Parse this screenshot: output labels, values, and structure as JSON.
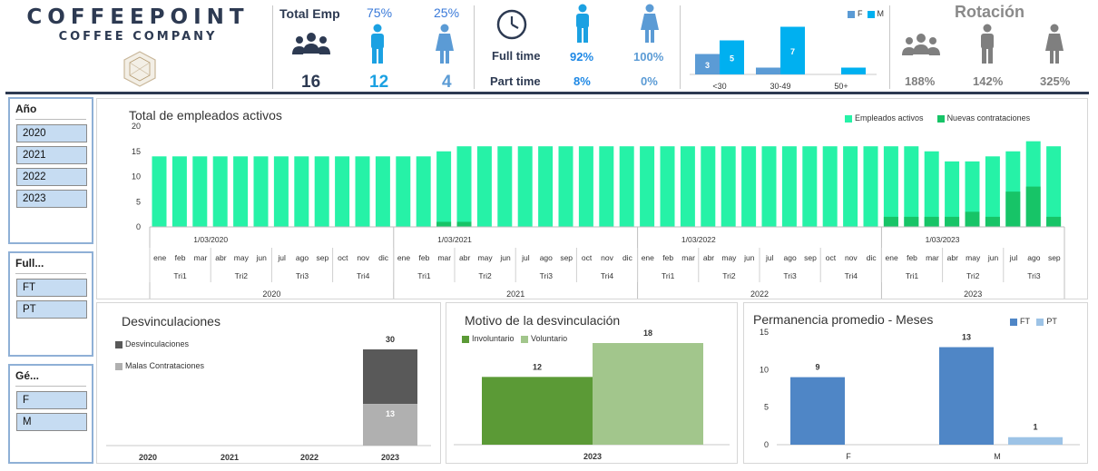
{
  "header": {
    "logo_title": "COFFEEPOINT",
    "logo_subtitle": "COFFEE COMPANY",
    "total_emp_label": "Total Emp",
    "total_emp_value": "16",
    "male_pct": "75%",
    "male_value": "12",
    "female_pct": "25%",
    "female_value": "4",
    "full_time_label": "Full time",
    "part_time_label": "Part time",
    "full_time_male": "92%",
    "full_time_female": "100%",
    "part_time_male": "8%",
    "part_time_female": "0%",
    "rotation_title": "Rotación",
    "rotation_total": "188%",
    "rotation_male": "142%",
    "rotation_female": "325%",
    "colors": {
      "navy": "#2d3a52",
      "blue": "#1ba1e2",
      "female_blue": "#5b9bd5",
      "gray_icon": "#7f7f7f"
    }
  },
  "age_chart": {
    "legend": [
      "F",
      "M"
    ],
    "colors": {
      "F": "#5b9bd5",
      "M": "#00b0f0"
    },
    "chart_data": {
      "type": "bar",
      "categories": [
        "<30",
        "30-49",
        "50+"
      ],
      "series": [
        {
          "name": "F",
          "values": [
            3,
            1,
            0
          ]
        },
        {
          "name": "M",
          "values": [
            5,
            7,
            1
          ]
        }
      ],
      "data_labels": {
        "F": [
          "3",
          "",
          ""
        ],
        "M": [
          "5",
          "7",
          ""
        ]
      }
    }
  },
  "slicers": {
    "year": {
      "title": "Año",
      "items": [
        "2020",
        "2021",
        "2022",
        "2023"
      ]
    },
    "contract": {
      "title": "Full...",
      "items": [
        "FT",
        "PT"
      ]
    },
    "gender": {
      "title": "Gé...",
      "items": [
        "F",
        "M"
      ]
    }
  },
  "main_chart": {
    "title": "Total de empleados activos",
    "legend": [
      "Empleados activos",
      "Nuevas contrataciones"
    ],
    "colors": {
      "active": "#26f2a7",
      "new": "#17c467"
    },
    "y_ticks": [
      "0",
      "5",
      "10",
      "15",
      "20"
    ],
    "months": [
      "ene",
      "feb",
      "mar",
      "abr",
      "may",
      "jun",
      "jul",
      "ago",
      "sep",
      "oct",
      "nov",
      "dic"
    ],
    "quarters": [
      "Tri1",
      "Tri2",
      "Tri3",
      "Tri4"
    ],
    "quarter_date": [
      "1/03/2020",
      "1/03/2021",
      "1/03/2022",
      "1/03/2023"
    ],
    "years": [
      "2020",
      "2021",
      "2022",
      "2023"
    ],
    "chart_data": {
      "type": "bar",
      "ylim": [
        0,
        20
      ],
      "x": [
        "2020-01",
        "2020-02",
        "2020-03",
        "2020-04",
        "2020-05",
        "2020-06",
        "2020-07",
        "2020-08",
        "2020-09",
        "2020-10",
        "2020-11",
        "2020-12",
        "2021-01",
        "2021-02",
        "2021-03",
        "2021-04",
        "2021-05",
        "2021-06",
        "2021-07",
        "2021-08",
        "2021-09",
        "2021-10",
        "2021-11",
        "2021-12",
        "2022-01",
        "2022-02",
        "2022-03",
        "2022-04",
        "2022-05",
        "2022-06",
        "2022-07",
        "2022-08",
        "2022-09",
        "2022-10",
        "2022-11",
        "2022-12",
        "2023-01",
        "2023-02",
        "2023-03",
        "2023-04",
        "2023-05",
        "2023-06",
        "2023-07",
        "2023-08",
        "2023-09"
      ],
      "series": [
        {
          "name": "Empleados activos",
          "values": [
            14,
            14,
            14,
            14,
            14,
            14,
            14,
            14,
            14,
            14,
            14,
            14,
            14,
            14,
            15,
            16,
            16,
            16,
            16,
            16,
            16,
            16,
            16,
            16,
            16,
            16,
            16,
            16,
            16,
            16,
            16,
            16,
            16,
            16,
            16,
            16,
            16,
            16,
            15,
            13,
            13,
            14,
            15,
            17,
            16
          ]
        },
        {
          "name": "Nuevas contrataciones",
          "values": [
            0,
            0,
            0,
            0,
            0,
            0,
            0,
            0,
            0,
            0,
            0,
            0,
            0,
            0,
            1,
            1,
            0,
            0,
            0,
            0,
            0,
            0,
            0,
            0,
            0,
            0,
            0,
            0,
            0,
            0,
            0,
            0,
            0,
            0,
            0,
            0,
            2,
            2,
            2,
            2,
            3,
            2,
            7,
            8,
            2
          ]
        }
      ]
    }
  },
  "desvinc_chart": {
    "title": "Desvinculaciones",
    "legend": [
      "Desvinculaciones",
      "Malas Contrataciones"
    ],
    "colors": {
      "desv": "#595959",
      "malas": "#b0b0b0"
    },
    "chart_data": {
      "type": "bar",
      "categories": [
        "2020",
        "2021",
        "2022",
        "2023"
      ],
      "series": [
        {
          "name": "Desvinculaciones",
          "values": [
            0,
            0,
            0,
            30
          ]
        },
        {
          "name": "Malas Contrataciones",
          "values": [
            0,
            0,
            0,
            13
          ]
        }
      ],
      "data_labels": {
        "total": "30",
        "malas": "13"
      }
    }
  },
  "motivo_chart": {
    "title": "Motivo de la desvinculación",
    "legend": [
      "Involuntario",
      "Voluntario"
    ],
    "colors": {
      "inv": "#5b9a36",
      "vol": "#a2c68c"
    },
    "chart_data": {
      "type": "bar",
      "categories": [
        "2023"
      ],
      "series": [
        {
          "name": "Involuntario",
          "values": [
            12
          ]
        },
        {
          "name": "Voluntario",
          "values": [
            18
          ]
        }
      ],
      "data_labels": [
        "12",
        "18"
      ]
    }
  },
  "perm_chart": {
    "title": "Permanencia promedio - Meses",
    "legend": [
      "FT",
      "PT"
    ],
    "colors": {
      "FT": "#4f86c6",
      "PT": "#9dc3e6"
    },
    "y_ticks": [
      "0",
      "5",
      "10",
      "15"
    ],
    "chart_data": {
      "type": "bar",
      "ylim": [
        0,
        15
      ],
      "categories": [
        "F",
        "M"
      ],
      "series": [
        {
          "name": "FT",
          "values": [
            9,
            13
          ]
        },
        {
          "name": "PT",
          "values": [
            0,
            1
          ]
        }
      ],
      "data_labels": {
        "FT": [
          "9",
          "13"
        ],
        "PT": [
          "",
          "1"
        ]
      }
    }
  }
}
